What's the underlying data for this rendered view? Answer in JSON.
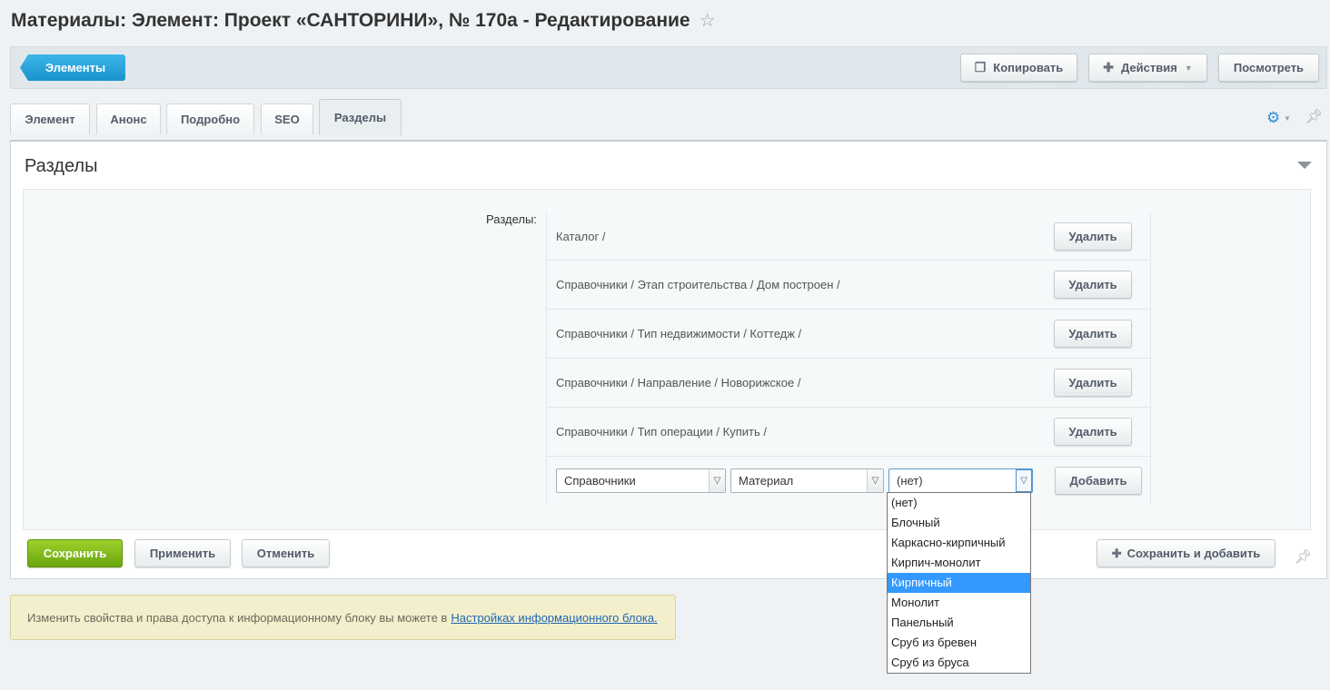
{
  "page": {
    "title": "Материалы: Элемент: Проект «САНТОРИНИ», № 170а - Редактирование",
    "star_icon": "☆"
  },
  "toolbar": {
    "back_label": "Элементы",
    "copy_label": "Копировать",
    "actions_label": "Действия",
    "view_label": "Посмотреть"
  },
  "tabs": [
    {
      "label": "Элемент"
    },
    {
      "label": "Анонс"
    },
    {
      "label": "Подробно"
    },
    {
      "label": "SEO"
    },
    {
      "label": "Разделы",
      "active": true
    }
  ],
  "panel": {
    "title": "Разделы",
    "field_label": "Разделы:",
    "sections": [
      {
        "path": "Каталог /",
        "button": "Удалить"
      },
      {
        "path": "Справочники / Этап строительства / Дом построен /",
        "button": "Удалить"
      },
      {
        "path": "Справочники / Тип недвижимости / Коттедж /",
        "button": "Удалить"
      },
      {
        "path": "Справочники / Направление / Новорижское /",
        "button": "Удалить"
      },
      {
        "path": "Справочники / Тип операции / Купить /",
        "button": "Удалить"
      }
    ],
    "add_row": {
      "select1": "Справочники",
      "select2": "Материал",
      "select3": "(нет)",
      "add_button": "Добавить"
    },
    "dropdown_options": [
      "(нет)",
      "Блочный",
      "Каркасно-кирпичный",
      "Кирпич-монолит",
      "Кирпичный",
      "Монолит",
      "Панельный",
      "Сруб из бревен",
      "Сруб из бруса"
    ],
    "dropdown_selected": "Кирпичный"
  },
  "bottom": {
    "save": "Сохранить",
    "apply": "Применить",
    "cancel": "Отменить",
    "save_add": "Сохранить и добавить"
  },
  "notice": {
    "text": "Изменить свойства и права доступа к информационному блоку вы можете в",
    "link": "Настройках информационного блока."
  },
  "colors": {
    "accent_blue": "#1a92cd",
    "save_green": "#6aa60f",
    "dropdown_highlight": "#3399ff",
    "notice_bg": "#f3efcd"
  }
}
